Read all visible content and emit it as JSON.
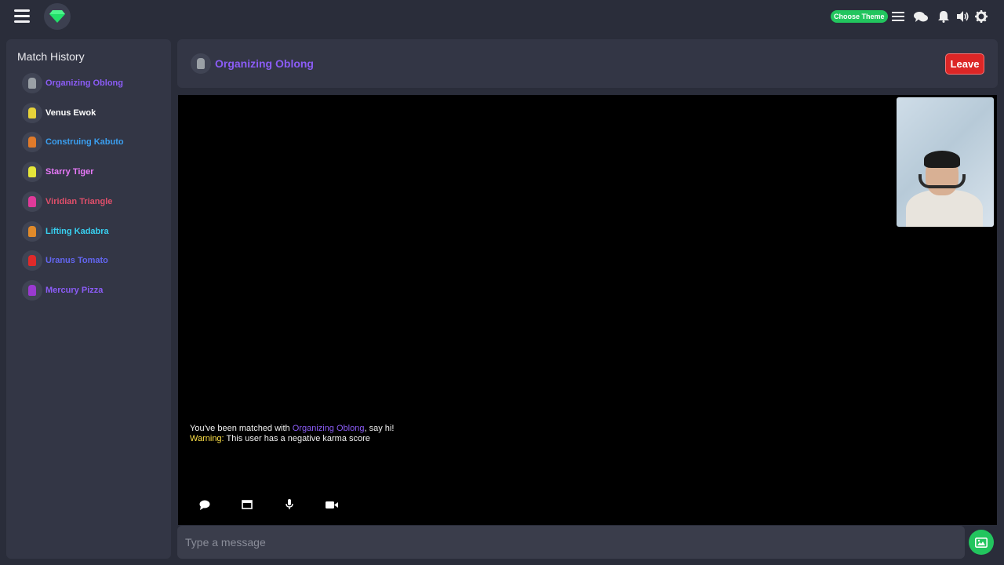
{
  "topbar": {
    "theme_button": "Choose Theme",
    "icons": [
      "menu-icon",
      "gem-logo-icon",
      "list-icon",
      "chat-bubbles-icon",
      "bell-icon",
      "speaker-icon",
      "gear-icon"
    ],
    "accent": "#22c55e"
  },
  "sidebar": {
    "title": "Match History",
    "items": [
      {
        "name": "Organizing Oblong",
        "color": "#8b5cf6",
        "avatar_color": "#9aa0a6"
      },
      {
        "name": "Venus Ewok",
        "color": "#ffffff",
        "avatar_color": "#e6d23a"
      },
      {
        "name": "Construing Kabuto",
        "color": "#3b9ff0",
        "avatar_color": "#e07a2a"
      },
      {
        "name": "Starry Tiger",
        "color": "#e879f9",
        "avatar_color": "#e6e63a"
      },
      {
        "name": "Viridian Triangle",
        "color": "#e04f6a",
        "avatar_color": "#e03a9a"
      },
      {
        "name": "Lifting Kadabra",
        "color": "#38d0f0",
        "avatar_color": "#e08a2a"
      },
      {
        "name": "Uranus Tomato",
        "color": "#6366f1",
        "avatar_color": "#e02a2a"
      },
      {
        "name": "Mercury Pizza",
        "color": "#8b5cf6",
        "avatar_color": "#9a3ad0"
      }
    ]
  },
  "header": {
    "partner_name": "Organizing Oblong",
    "leave_label": "Leave"
  },
  "messages": {
    "matched_prefix": "You've been matched with",
    "matched_name": "Organizing Oblong",
    "matched_suffix": ", say hi!",
    "warning_label": "Warning:",
    "warning_text": "This user has a negative karma score"
  },
  "controls": [
    "chat-icon",
    "window-icon",
    "microphone-icon",
    "video-camera-icon"
  ],
  "input": {
    "placeholder": "Type a message"
  },
  "colors": {
    "background": "#2a2d3a",
    "panel": "#333645",
    "leave": "#dc2626",
    "accent": "#22c55e",
    "partner": "#8b5cf6",
    "warning": "#fde047"
  }
}
